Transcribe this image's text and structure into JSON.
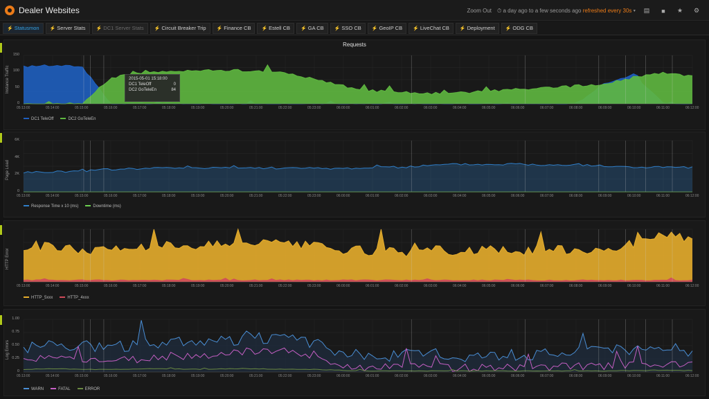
{
  "app": {
    "title": "Dealer Websites",
    "zoom_label": "Zoom Out",
    "time_range": "a day ago to a few seconds ago",
    "refresh": "refreshed every 30s",
    "icons": [
      "save-icon",
      "folder-icon",
      "star-icon",
      "gear-icon"
    ]
  },
  "tabs": [
    {
      "label": "Statusmon",
      "active": true,
      "muted": false
    },
    {
      "label": "Server Stats",
      "active": false,
      "muted": false
    },
    {
      "label": "DC1 Server Stats",
      "active": false,
      "muted": true
    },
    {
      "label": "Circuit Breaker Trip",
      "active": false,
      "muted": false
    },
    {
      "label": "Finance CB",
      "active": false,
      "muted": false
    },
    {
      "label": "Estell CB",
      "active": false,
      "muted": false
    },
    {
      "label": "GA CB",
      "active": false,
      "muted": false
    },
    {
      "label": "SSO CB",
      "active": false,
      "muted": false
    },
    {
      "label": "GeoIP CB",
      "active": false,
      "muted": false
    },
    {
      "label": "LiveChat CB",
      "active": false,
      "muted": false
    },
    {
      "label": "Deployment",
      "active": false,
      "muted": false
    },
    {
      "label": "ODG CB",
      "active": false,
      "muted": false
    }
  ],
  "tooltip": {
    "time": "2015-05-01 15:18:00",
    "rows": [
      {
        "name": "DC1 TeleOff",
        "value": "0"
      },
      {
        "name": "DC2 GoTeleEn",
        "value": "84"
      }
    ]
  },
  "chart_data": [
    {
      "type": "area",
      "title": "Requests",
      "ylabel": "Instance Traffic",
      "yticks": [
        "150",
        "100",
        "50",
        "0"
      ],
      "ylim": [
        0,
        150
      ],
      "x": [
        "05:13:00",
        "05:14:00",
        "05:15:00",
        "05:16:00",
        "05:17:00",
        "05:18:00",
        "05:19:00",
        "05:20:00",
        "05:21:00",
        "05:22:00",
        "05:23:00",
        "06:00:00",
        "06:01:00",
        "06:02:00",
        "06:03:00",
        "06:04:00",
        "06:05:00",
        "06:06:00",
        "06:07:00",
        "06:08:00",
        "06:09:00",
        "06:10:00",
        "06:11:00",
        "06:12:00"
      ],
      "series": [
        {
          "name": "DC1 TeleOff",
          "color": "#1f5fbf",
          "values": [
            115,
            118,
            116,
            0,
            0,
            0,
            0,
            0,
            0,
            0,
            0,
            0,
            0,
            0,
            0,
            0,
            0,
            0,
            0,
            0,
            65,
            90,
            0,
            0
          ]
        },
        {
          "name": "DC2 GoTeleEn",
          "color": "#5fb840",
          "values": [
            0,
            0,
            0,
            80,
            95,
            100,
            102,
            104,
            102,
            95,
            78,
            55,
            40,
            35,
            32,
            34,
            40,
            45,
            48,
            55,
            60,
            82,
            95,
            85
          ]
        }
      ]
    },
    {
      "type": "area",
      "title": "",
      "ylabel": "Page Load",
      "yticks": [
        "6K",
        "4K",
        "2K",
        "0"
      ],
      "ylim": [
        0,
        6000
      ],
      "x": [
        "05:13:00",
        "05:14:00",
        "05:15:00",
        "05:16:00",
        "05:17:00",
        "05:18:00",
        "05:19:00",
        "05:20:00",
        "05:21:00",
        "05:22:00",
        "05:23:00",
        "06:00:00",
        "06:01:00",
        "06:02:00",
        "06:03:00",
        "06:04:00",
        "06:05:00",
        "06:06:00",
        "06:07:00",
        "06:08:00",
        "06:09:00",
        "06:10:00",
        "06:11:00",
        "06:12:00"
      ],
      "series": [
        {
          "name": "Response Time x 10 (ms)",
          "color": "#2f7ec8",
          "values": [
            2300,
            2350,
            2450,
            2650,
            2750,
            2800,
            2850,
            2850,
            2800,
            2800,
            2750,
            2750,
            2850,
            2900,
            3100,
            3250,
            3200,
            3300,
            3100,
            3200,
            3000,
            2900,
            2900,
            2850
          ]
        },
        {
          "name": "Downtime (ms)",
          "color": "#6ccf50",
          "values": [
            0,
            0,
            0,
            0,
            0,
            0,
            0,
            0,
            0,
            0,
            0,
            0,
            0,
            0,
            0,
            0,
            0,
            0,
            0,
            0,
            0,
            0,
            0,
            0
          ]
        }
      ]
    },
    {
      "type": "area",
      "title": "",
      "ylabel": "HTTP Error",
      "yticks": [],
      "ylim": [
        0,
        100
      ],
      "x": [
        "05:13:00",
        "05:14:00",
        "05:15:00",
        "05:16:00",
        "05:17:00",
        "05:18:00",
        "05:19:00",
        "05:20:00",
        "05:21:00",
        "05:22:00",
        "05:23:00",
        "06:00:00",
        "06:01:00",
        "06:02:00",
        "06:03:00",
        "06:04:00",
        "06:05:00",
        "06:06:00",
        "06:07:00",
        "06:08:00",
        "06:09:00",
        "06:10:00",
        "06:11:00",
        "06:12:00"
      ],
      "series": [
        {
          "name": "HTTP_5xxx",
          "color": "#e5ad2c",
          "values": [
            62,
            68,
            60,
            62,
            66,
            72,
            70,
            72,
            75,
            70,
            68,
            60,
            58,
            56,
            62,
            58,
            60,
            58,
            62,
            60,
            64,
            72,
            88,
            82
          ]
        },
        {
          "name": "HTTP_4xxx",
          "color": "#d04a5a",
          "values": [
            3,
            3,
            3,
            3,
            3,
            3,
            3,
            3,
            3,
            3,
            3,
            3,
            3,
            3,
            3,
            3,
            3,
            3,
            3,
            3,
            3,
            3,
            3,
            3
          ]
        }
      ]
    },
    {
      "type": "line",
      "title": "",
      "ylabel": "Log Errors",
      "yticks": [
        "1.00",
        "0.75",
        "0.50",
        "0.25",
        "0"
      ],
      "ylim": [
        0,
        1
      ],
      "x": [
        "05:13:00",
        "05:14:00",
        "05:15:00",
        "05:16:00",
        "05:17:00",
        "05:18:00",
        "05:19:00",
        "05:20:00",
        "05:21:00",
        "05:22:00",
        "05:23:00",
        "06:00:00",
        "06:01:00",
        "06:02:00",
        "06:03:00",
        "06:04:00",
        "06:05:00",
        "06:06:00",
        "06:07:00",
        "06:08:00",
        "06:09:00",
        "06:10:00",
        "06:11:00",
        "06:12:00"
      ],
      "series": [
        {
          "name": "WARN",
          "color": "#4a8fd6",
          "values": [
            0.45,
            0.55,
            0.5,
            0.48,
            0.52,
            0.58,
            0.55,
            0.6,
            0.65,
            0.62,
            0.55,
            0.35,
            0.3,
            0.32,
            0.35,
            0.3,
            0.33,
            0.32,
            0.36,
            0.38,
            0.42,
            0.4,
            0.45,
            0.4
          ]
        },
        {
          "name": "FATAL",
          "color": "#c55fc4",
          "values": [
            0.2,
            0.28,
            0.25,
            0.22,
            0.25,
            0.3,
            0.32,
            0.35,
            0.4,
            0.38,
            0.3,
            0.1,
            0.08,
            0.08,
            0.09,
            0.08,
            0.09,
            0.08,
            0.1,
            0.1,
            0.12,
            0.12,
            0.14,
            0.12
          ]
        },
        {
          "name": "ERROR",
          "color": "#6a8a42",
          "values": [
            0.05,
            0.06,
            0.05,
            0.05,
            0.06,
            0.06,
            0.05,
            0.06,
            0.06,
            0.05,
            0.05,
            0.03,
            0.02,
            0.02,
            0.02,
            0.02,
            0.02,
            0.02,
            0.02,
            0.02,
            0.02,
            0.03,
            0.03,
            0.03
          ]
        }
      ]
    }
  ]
}
